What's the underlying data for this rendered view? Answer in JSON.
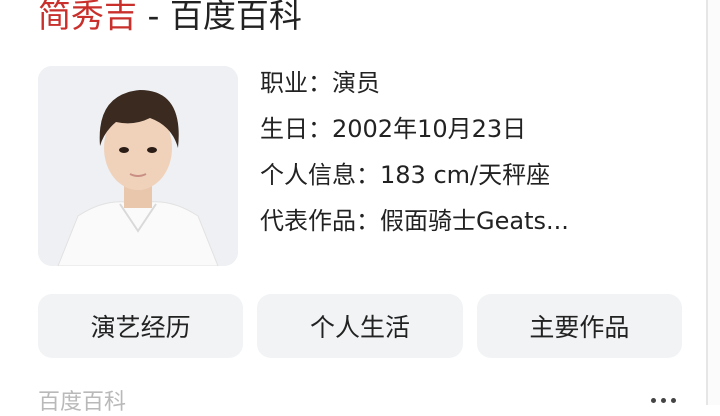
{
  "title": {
    "name": "简秀吉",
    "suffix": " - 百度百科"
  },
  "info": [
    {
      "label": "职业：",
      "value": "演员"
    },
    {
      "label": "生日：",
      "value": "2002年10月23日"
    },
    {
      "label": "个人信息：",
      "value": "183 cm/天秤座"
    },
    {
      "label": "代表作品：",
      "value": "假面骑士Geats..."
    }
  ],
  "tabs": [
    "演艺经历",
    "个人生活",
    "主要作品"
  ],
  "footer": {
    "source": "百度百科"
  },
  "colors": {
    "title_name": "#c9302c",
    "tab_bg": "#f1f3f5",
    "muted": "#b9b9b9"
  }
}
